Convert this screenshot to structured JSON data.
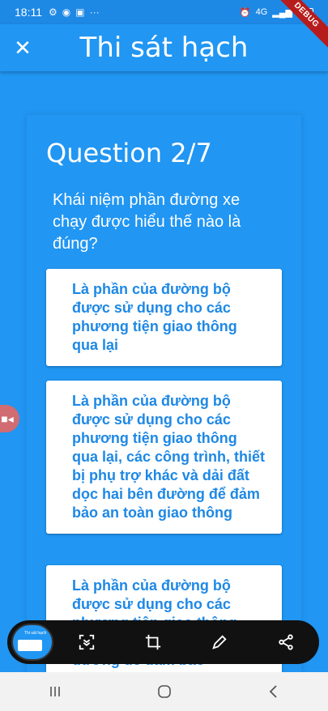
{
  "status": {
    "time": "18:11",
    "left_icons": [
      "gear-sim-icon",
      "messenger-icon",
      "image-icon",
      "more-dots-icon"
    ],
    "network": "4G"
  },
  "debug_banner": "DEBUG",
  "app_bar": {
    "title": "Thi sát hạch"
  },
  "quiz": {
    "heading": "Question 2/7",
    "question": "Khái niệm phần đường xe chạy được hiểu thế nào là đúng?",
    "answers": [
      "Là phần của đường bộ được sử dụng cho các phương tiện giao thông qua lại",
      "Là phần của đường bộ được sử dụng cho các phương tiện giao thông qua lại, các công trình, thiết bị phụ trợ khác và dải đất dọc hai bên đường để đảm bảo an toàn giao thông",
      "Là phần của đường bộ được sử dụng cho các phương tiện giao thông qua lại, dải đất dọc hai bên đường để đảm bảo"
    ]
  },
  "toolbar": {
    "thumbnail_title": "Thi sát hạch",
    "tools": [
      "scroll-capture-icon",
      "crop-icon",
      "pen-icon",
      "share-icon"
    ]
  },
  "nav": [
    "recent-apps-icon",
    "home-icon",
    "back-icon"
  ]
}
